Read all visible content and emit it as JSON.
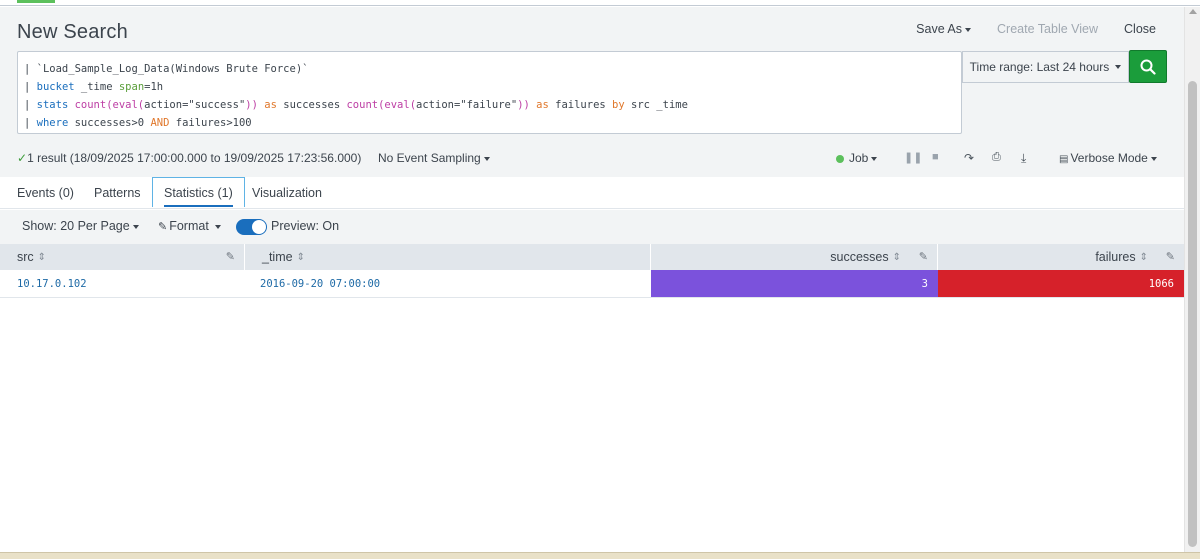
{
  "header": {
    "title": "New Search",
    "save_as": "Save As",
    "create_table_view": "Create Table View",
    "close": "Close"
  },
  "search": {
    "line1": "| `Load_Sample_Log_Data(Windows Brute Force)`",
    "line2_kw": "bucket",
    "line2_rest": " _time ",
    "line2_arg": "span",
    "line2_tail": "=1h",
    "line3_pipe": "| ",
    "line3_cmd": "stats",
    "line3_fn1": "count(eval(",
    "line3_a1": "action=\"success\"",
    "line3_close1": "))",
    "line3_as1": "as",
    "line3_f1": " successes ",
    "line3_fn2": "count(eval(",
    "line3_a2": "action=\"failure\"",
    "line3_close2": "))",
    "line3_as2": "as",
    "line3_f2": " failures ",
    "line3_by": "by",
    "line3_f3": " src _time",
    "line4_cmd": "where",
    "line4_a": " successes>0 ",
    "line4_and": "AND",
    "line4_b": " failures>100"
  },
  "time_range": {
    "label": "Time range: Last 24 hours"
  },
  "status": {
    "result": "1 result (18/09/2025 17:00:00.000 to 19/09/2025 17:23:56.000)",
    "sampling": "No Event Sampling",
    "job": "Job",
    "verbose": "Verbose Mode"
  },
  "tabs": [
    {
      "label": "Events (0)"
    },
    {
      "label": "Patterns"
    },
    {
      "label": "Statistics (1)"
    },
    {
      "label": "Visualization"
    }
  ],
  "toolbar": {
    "show": "Show: 20 Per Page",
    "format": "Format",
    "preview": "Preview: On"
  },
  "table": {
    "columns": [
      "src",
      "_time",
      "successes",
      "failures"
    ],
    "rows": [
      {
        "src": "10.17.0.102",
        "_time": "2016-09-20 07:00:00",
        "successes": "3",
        "failures": "1066"
      }
    ]
  },
  "colors": {
    "successes_cell": "#7b52dc",
    "failures_cell": "#d6212a",
    "search_button": "#1b9d3b",
    "accent": "#1a6ebd"
  },
  "icons": {
    "search": "magnifier-icon",
    "pause": "pause-icon",
    "stop": "stop-icon",
    "share": "share-icon",
    "print": "print-icon",
    "export": "export-icon",
    "sort": "sort-icon",
    "edit": "pencil-icon"
  }
}
